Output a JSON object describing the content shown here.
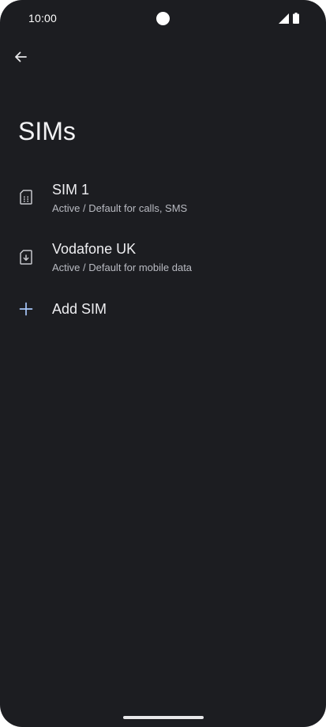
{
  "status_bar": {
    "time": "10:00"
  },
  "header": {
    "back_icon": "arrow-left-icon",
    "title": "SIMs"
  },
  "sims": [
    {
      "icon": "sim-card-icon",
      "title": "SIM 1",
      "subtitle": "Active / Default for calls, SMS"
    },
    {
      "icon": "esim-download-icon",
      "title": "Vodafone UK",
      "subtitle": "Active / Default for mobile data"
    }
  ],
  "add_sim": {
    "icon": "plus-icon",
    "label": "Add SIM"
  },
  "colors": {
    "background": "#1c1d21",
    "accent": "#a8c7fa",
    "text_primary": "#eeeef1",
    "text_secondary": "#b9bbc2"
  }
}
